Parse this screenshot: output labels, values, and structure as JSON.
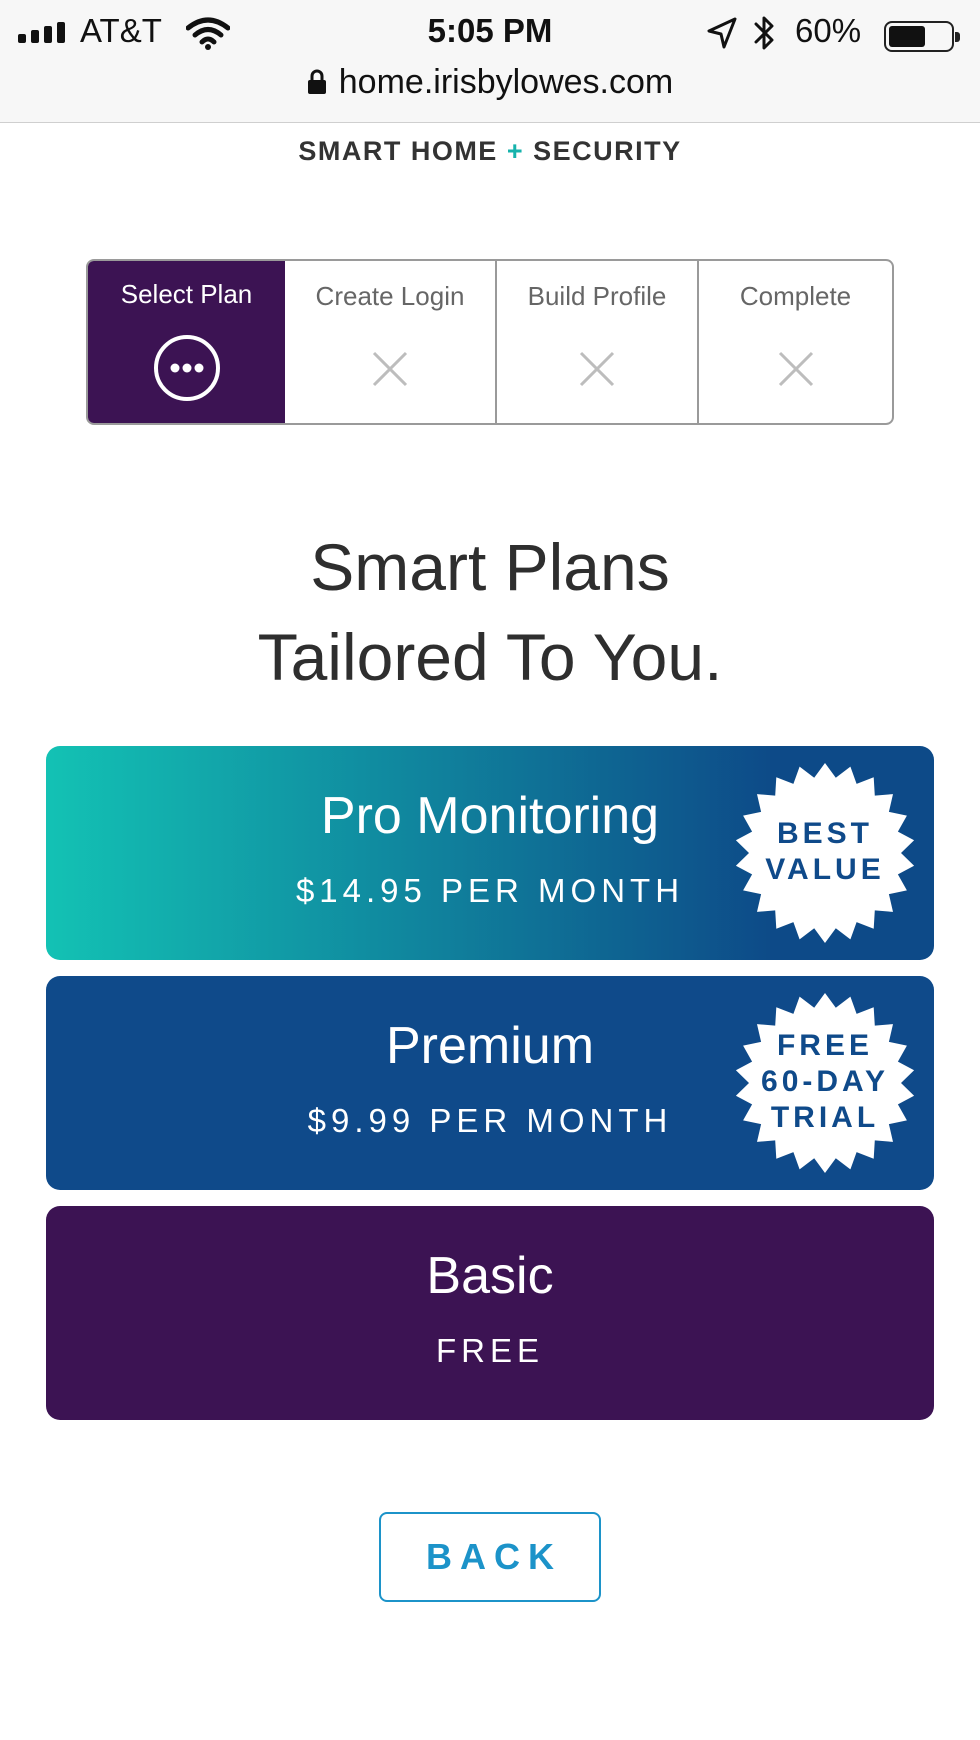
{
  "status_bar": {
    "carrier": "AT&T",
    "time": "5:05 PM",
    "battery": "60%",
    "battery_level": 0.6,
    "icons": [
      "signal-icon",
      "wifi-icon",
      "location-icon",
      "bluetooth-icon",
      "battery-icon"
    ]
  },
  "browser": {
    "url": "home.irisbylowes.com",
    "icon": "lock-icon"
  },
  "brand": {
    "tagline_left": "SMART HOME",
    "tagline_plus": "+",
    "tagline_right": "SECURITY",
    "color": "#3c1353",
    "accent": "#16b3ac"
  },
  "stepper": {
    "steps": [
      {
        "label": "Select Plan",
        "state": "active",
        "icon": "more-dots-icon"
      },
      {
        "label": "Create Login",
        "state": "incomplete",
        "icon": "x-icon"
      },
      {
        "label": "Build Profile",
        "state": "incomplete",
        "icon": "x-icon"
      },
      {
        "label": "Complete",
        "state": "incomplete",
        "icon": "x-icon"
      }
    ]
  },
  "headline": {
    "line1": "Smart Plans",
    "line2": "Tailored To You."
  },
  "plans": [
    {
      "name": "Pro Monitoring",
      "price": "$14.95 PER MONTH",
      "badge_line1": "BEST",
      "badge_line2": "VALUE",
      "colors": [
        "#13c2b4",
        "#0d4a88"
      ]
    },
    {
      "name": "Premium",
      "price": "$9.99 PER MONTH",
      "badge_line1": "FREE",
      "badge_line2": "60-DAY",
      "badge_line3": "TRIAL",
      "colors": [
        "#0f4a8a"
      ]
    },
    {
      "name": "Basic",
      "price": "FREE",
      "colors": [
        "#3c1353"
      ]
    }
  ],
  "back_button": {
    "label": "BACK",
    "color": "#1c93c9"
  }
}
